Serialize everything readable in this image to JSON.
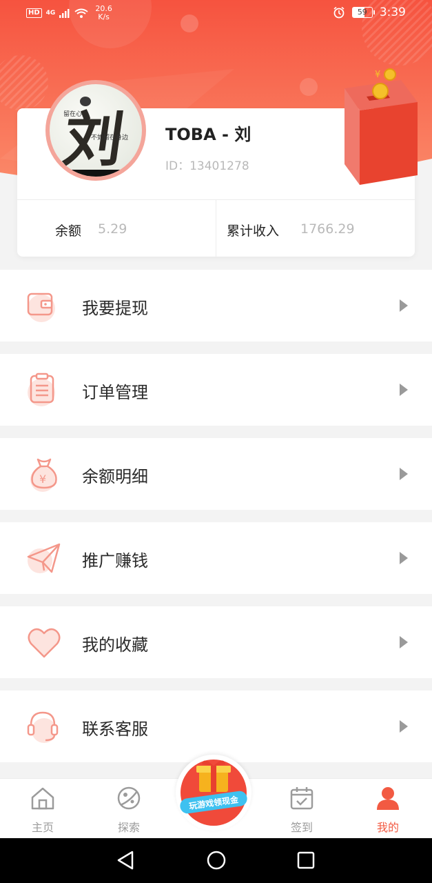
{
  "status_bar": {
    "hd": "HD",
    "network": "4G",
    "speed_value": "20.6",
    "speed_unit": "K/s",
    "battery": "59",
    "time": "3:39"
  },
  "profile": {
    "username": "TOBA - 刘",
    "id": "ID：13401278",
    "balance_label": "余额",
    "balance_value": "5.29",
    "income_label": "累计收入",
    "income_value": "1766.29"
  },
  "menu": [
    {
      "label": "我要提现",
      "icon": "wallet-icon"
    },
    {
      "label": "订单管理",
      "icon": "clipboard-icon"
    },
    {
      "label": "余额明细",
      "icon": "money-bag-icon"
    },
    {
      "label": "推广赚钱",
      "icon": "paper-plane-icon"
    },
    {
      "label": "我的收藏",
      "icon": "heart-icon"
    },
    {
      "label": "联系客服",
      "icon": "headset-icon"
    }
  ],
  "tabs": [
    {
      "label": "主页",
      "icon": "home-icon"
    },
    {
      "label": "探索",
      "icon": "planet-icon"
    },
    {
      "label": "签到",
      "icon": "calendar-icon"
    },
    {
      "label": "我的",
      "icon": "user-icon",
      "active": true
    }
  ],
  "promo_badge": "玩游戏领现金",
  "colors": {
    "accent": "#f25a42",
    "hero_top": "#f5513f",
    "icon_tint": "#f4978a"
  }
}
